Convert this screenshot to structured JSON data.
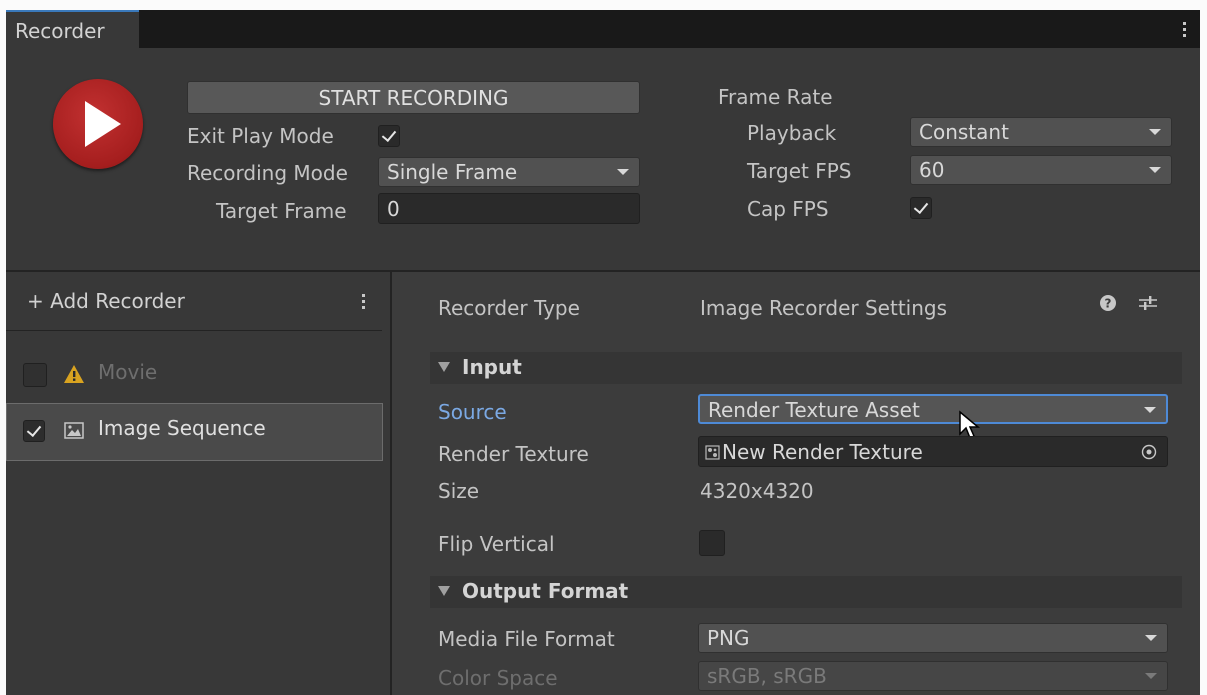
{
  "window": {
    "tab_title": "Recorder"
  },
  "controls": {
    "start_label": "START RECORDING",
    "exit_play_mode_label": "Exit Play Mode",
    "exit_play_mode_checked": true,
    "recording_mode_label": "Recording Mode",
    "recording_mode_value": "Single Frame",
    "target_frame_label": "Target Frame",
    "target_frame_value": "0"
  },
  "frame_rate": {
    "heading": "Frame Rate",
    "playback_label": "Playback",
    "playback_value": "Constant",
    "target_fps_label": "Target FPS",
    "target_fps_value": "60",
    "cap_fps_label": "Cap FPS",
    "cap_fps_checked": true
  },
  "recorder_list": {
    "add_label": "+ Add Recorder",
    "items": [
      {
        "label": "Movie",
        "checked": false,
        "icon": "warning-icon",
        "enabled": false
      },
      {
        "label": "Image Sequence",
        "checked": true,
        "icon": "image-icon",
        "enabled": true
      }
    ]
  },
  "settings": {
    "recorder_type_label": "Recorder Type",
    "recorder_type_value": "Image Recorder Settings",
    "input_section": "Input",
    "source_label": "Source",
    "source_value": "Render Texture Asset",
    "render_texture_label": "Render Texture",
    "render_texture_value": "New Render Texture",
    "size_label": "Size",
    "size_value": "4320x4320",
    "flip_vertical_label": "Flip Vertical",
    "flip_vertical_checked": false,
    "output_section": "Output Format",
    "media_format_label": "Media File Format",
    "media_format_value": "PNG",
    "color_space_label": "Color Space",
    "color_space_value": "sRGB, sRGB"
  },
  "colors": {
    "panel": "#383838",
    "accent_blue": "#3a79bb",
    "label_blue": "#7ba9e4",
    "play_red": "#a51e1e"
  }
}
